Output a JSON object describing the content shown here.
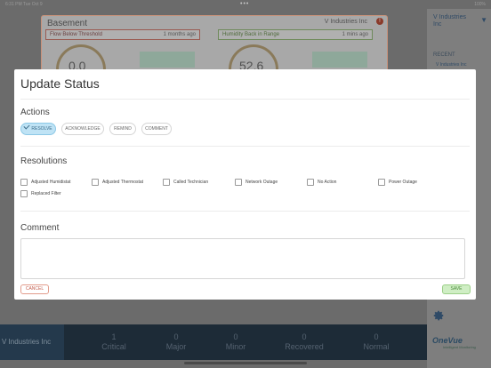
{
  "status_bar": {
    "time": "6:31 PM   Tue Oct 9",
    "dots": "•••",
    "battery": "100%"
  },
  "background": {
    "card": {
      "title": "Basement",
      "company": "V Industries Inc",
      "alert_icon": "exclamation-icon",
      "alerts": [
        {
          "label": "Flow Below Threshold",
          "ago": "1 months ago"
        },
        {
          "label": "Humidity Back in Range",
          "ago": "1 mins ago"
        }
      ],
      "gauges": [
        "0.0",
        "52.6"
      ]
    },
    "sidebar": {
      "company": "V Industries Inc",
      "caret": "▼",
      "recent_label": "RECENT",
      "recent_item": "V Industries Inc",
      "logo": "OneVue",
      "logo_sub": "Intelligent Monitoring"
    },
    "bottom_bar": {
      "org": "V Industries Inc",
      "stats": [
        {
          "count": "1",
          "label": "Critical"
        },
        {
          "count": "0",
          "label": "Major"
        },
        {
          "count": "0",
          "label": "Minor"
        },
        {
          "count": "0",
          "label": "Recovered"
        },
        {
          "count": "0",
          "label": "Normal"
        }
      ]
    }
  },
  "modal": {
    "title": "Update Status",
    "actions_heading": "Actions",
    "actions": [
      {
        "label": "RESOLVE",
        "selected": true
      },
      {
        "label": "ACKNOWLEDGE",
        "selected": false
      },
      {
        "label": "REMIND",
        "selected": false
      },
      {
        "label": "COMMENT",
        "selected": false
      }
    ],
    "resolutions_heading": "Resolutions",
    "resolutions": [
      "Adjusted Humidistat",
      "Adjusted Thermostat",
      "Called Technician",
      "Network Outage",
      "No Action",
      "Power Outage",
      "Replaced Filter"
    ],
    "comment_heading": "Comment",
    "comment_value": "",
    "cancel_label": "CANCEL",
    "save_label": "SAVE"
  },
  "colors": {
    "accent_selected": "#bfe3f5",
    "cancel": "#c25a4a",
    "save": "#4a8a3a",
    "bottom_bar": "#1d2b37"
  }
}
